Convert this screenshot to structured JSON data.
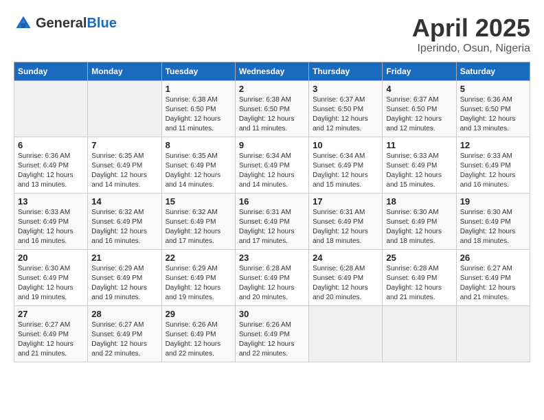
{
  "header": {
    "logo_general": "General",
    "logo_blue": "Blue",
    "month_title": "April 2025",
    "location": "Iperindo, Osun, Nigeria"
  },
  "weekdays": [
    "Sunday",
    "Monday",
    "Tuesday",
    "Wednesday",
    "Thursday",
    "Friday",
    "Saturday"
  ],
  "weeks": [
    [
      {
        "day": "",
        "info": ""
      },
      {
        "day": "",
        "info": ""
      },
      {
        "day": "1",
        "info": "Sunrise: 6:38 AM\nSunset: 6:50 PM\nDaylight: 12 hours and 11 minutes."
      },
      {
        "day": "2",
        "info": "Sunrise: 6:38 AM\nSunset: 6:50 PM\nDaylight: 12 hours and 11 minutes."
      },
      {
        "day": "3",
        "info": "Sunrise: 6:37 AM\nSunset: 6:50 PM\nDaylight: 12 hours and 12 minutes."
      },
      {
        "day": "4",
        "info": "Sunrise: 6:37 AM\nSunset: 6:50 PM\nDaylight: 12 hours and 12 minutes."
      },
      {
        "day": "5",
        "info": "Sunrise: 6:36 AM\nSunset: 6:50 PM\nDaylight: 12 hours and 13 minutes."
      }
    ],
    [
      {
        "day": "6",
        "info": "Sunrise: 6:36 AM\nSunset: 6:49 PM\nDaylight: 12 hours and 13 minutes."
      },
      {
        "day": "7",
        "info": "Sunrise: 6:35 AM\nSunset: 6:49 PM\nDaylight: 12 hours and 14 minutes."
      },
      {
        "day": "8",
        "info": "Sunrise: 6:35 AM\nSunset: 6:49 PM\nDaylight: 12 hours and 14 minutes."
      },
      {
        "day": "9",
        "info": "Sunrise: 6:34 AM\nSunset: 6:49 PM\nDaylight: 12 hours and 14 minutes."
      },
      {
        "day": "10",
        "info": "Sunrise: 6:34 AM\nSunset: 6:49 PM\nDaylight: 12 hours and 15 minutes."
      },
      {
        "day": "11",
        "info": "Sunrise: 6:33 AM\nSunset: 6:49 PM\nDaylight: 12 hours and 15 minutes."
      },
      {
        "day": "12",
        "info": "Sunrise: 6:33 AM\nSunset: 6:49 PM\nDaylight: 12 hours and 16 minutes."
      }
    ],
    [
      {
        "day": "13",
        "info": "Sunrise: 6:33 AM\nSunset: 6:49 PM\nDaylight: 12 hours and 16 minutes."
      },
      {
        "day": "14",
        "info": "Sunrise: 6:32 AM\nSunset: 6:49 PM\nDaylight: 12 hours and 16 minutes."
      },
      {
        "day": "15",
        "info": "Sunrise: 6:32 AM\nSunset: 6:49 PM\nDaylight: 12 hours and 17 minutes."
      },
      {
        "day": "16",
        "info": "Sunrise: 6:31 AM\nSunset: 6:49 PM\nDaylight: 12 hours and 17 minutes."
      },
      {
        "day": "17",
        "info": "Sunrise: 6:31 AM\nSunset: 6:49 PM\nDaylight: 12 hours and 18 minutes."
      },
      {
        "day": "18",
        "info": "Sunrise: 6:30 AM\nSunset: 6:49 PM\nDaylight: 12 hours and 18 minutes."
      },
      {
        "day": "19",
        "info": "Sunrise: 6:30 AM\nSunset: 6:49 PM\nDaylight: 12 hours and 18 minutes."
      }
    ],
    [
      {
        "day": "20",
        "info": "Sunrise: 6:30 AM\nSunset: 6:49 PM\nDaylight: 12 hours and 19 minutes."
      },
      {
        "day": "21",
        "info": "Sunrise: 6:29 AM\nSunset: 6:49 PM\nDaylight: 12 hours and 19 minutes."
      },
      {
        "day": "22",
        "info": "Sunrise: 6:29 AM\nSunset: 6:49 PM\nDaylight: 12 hours and 19 minutes."
      },
      {
        "day": "23",
        "info": "Sunrise: 6:28 AM\nSunset: 6:49 PM\nDaylight: 12 hours and 20 minutes."
      },
      {
        "day": "24",
        "info": "Sunrise: 6:28 AM\nSunset: 6:49 PM\nDaylight: 12 hours and 20 minutes."
      },
      {
        "day": "25",
        "info": "Sunrise: 6:28 AM\nSunset: 6:49 PM\nDaylight: 12 hours and 21 minutes."
      },
      {
        "day": "26",
        "info": "Sunrise: 6:27 AM\nSunset: 6:49 PM\nDaylight: 12 hours and 21 minutes."
      }
    ],
    [
      {
        "day": "27",
        "info": "Sunrise: 6:27 AM\nSunset: 6:49 PM\nDaylight: 12 hours and 21 minutes."
      },
      {
        "day": "28",
        "info": "Sunrise: 6:27 AM\nSunset: 6:49 PM\nDaylight: 12 hours and 22 minutes."
      },
      {
        "day": "29",
        "info": "Sunrise: 6:26 AM\nSunset: 6:49 PM\nDaylight: 12 hours and 22 minutes."
      },
      {
        "day": "30",
        "info": "Sunrise: 6:26 AM\nSunset: 6:49 PM\nDaylight: 12 hours and 22 minutes."
      },
      {
        "day": "",
        "info": ""
      },
      {
        "day": "",
        "info": ""
      },
      {
        "day": "",
        "info": ""
      }
    ]
  ]
}
